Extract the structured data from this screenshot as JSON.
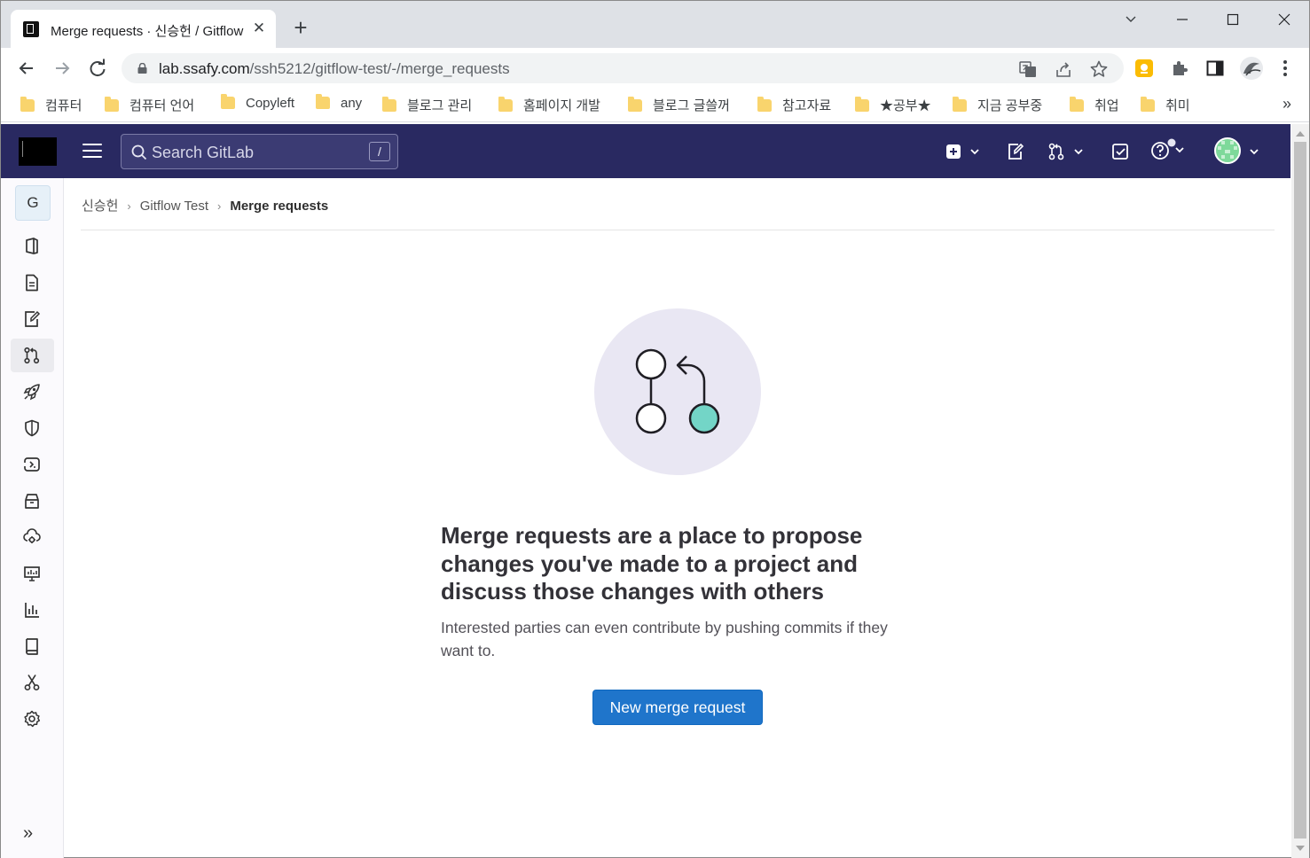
{
  "browser": {
    "tab": {
      "title": "Merge requests · 신승헌 / Gitflow Test · GitLab",
      "close": "✕"
    },
    "new_tab": "+",
    "url": {
      "host": "lab.ssafy.com",
      "path": "/ssh5212/gitflow-test/-/merge_requests"
    },
    "bookmarks": [
      {
        "label": "컴퓨터"
      },
      {
        "label": "컴퓨터 언어"
      },
      {
        "label": "Copyleft"
      },
      {
        "label": "any"
      },
      {
        "label": "블로그 관리"
      },
      {
        "label": "홈페이지 개발"
      },
      {
        "label": "블로그 글쓸꺼"
      },
      {
        "label": "참고자료"
      },
      {
        "label": "★공부★"
      },
      {
        "label": "지금 공부중"
      },
      {
        "label": "취업"
      },
      {
        "label": "취미"
      }
    ],
    "bookmarks_more": "»"
  },
  "gitlab": {
    "search": {
      "placeholder": "Search GitLab",
      "shortcut": "/"
    },
    "project_avatar": "G",
    "breadcrumbs": [
      {
        "label": "신승헌"
      },
      {
        "label": "Gitflow Test"
      },
      {
        "label": "Merge requests"
      }
    ],
    "empty_state": {
      "title": "Merge requests are a place to propose changes you've made to a project and discuss those changes with others",
      "description": "Interested parties can even contribute by pushing commits if they want to.",
      "button": "New merge request"
    },
    "collapse": "»",
    "colors": {
      "header_bg": "#292961",
      "primary": "#1f75cb",
      "illus_bg": "#e9e7f3",
      "teal": "#73d5c7"
    }
  }
}
